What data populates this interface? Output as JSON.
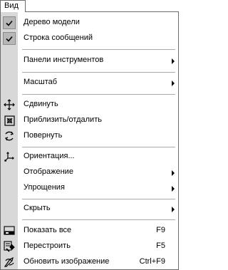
{
  "menubar": {
    "tab_label": "Вид"
  },
  "menu": {
    "items": [
      {
        "label": "Дерево модели",
        "checked": true,
        "icon": "check-icon"
      },
      {
        "label": "Строка сообщений",
        "checked": true,
        "icon": "check-icon"
      },
      {
        "label": "Панели инструментов",
        "submenu": true
      },
      {
        "label": "Масштаб",
        "submenu": true
      },
      {
        "label": "Сдвинуть",
        "icon": "move-arrows-icon"
      },
      {
        "label": "Приблизить/отдалить",
        "icon": "zoom-box-icon"
      },
      {
        "label": "Повернуть",
        "icon": "rotate-icon"
      },
      {
        "label": "Ориентация...",
        "icon": "axes-icon"
      },
      {
        "label": "Отображение",
        "submenu": true
      },
      {
        "label": "Упрощения",
        "submenu": true
      },
      {
        "label": "Скрыть",
        "submenu": true
      },
      {
        "label": "Показать все",
        "shortcut": "F9",
        "icon": "show-all-icon"
      },
      {
        "label": "Перестроить",
        "shortcut": "F5",
        "icon": "rebuild-icon"
      },
      {
        "label": "Обновить изображение",
        "shortcut": "Ctrl+F9",
        "icon": "refresh-icon"
      }
    ]
  }
}
